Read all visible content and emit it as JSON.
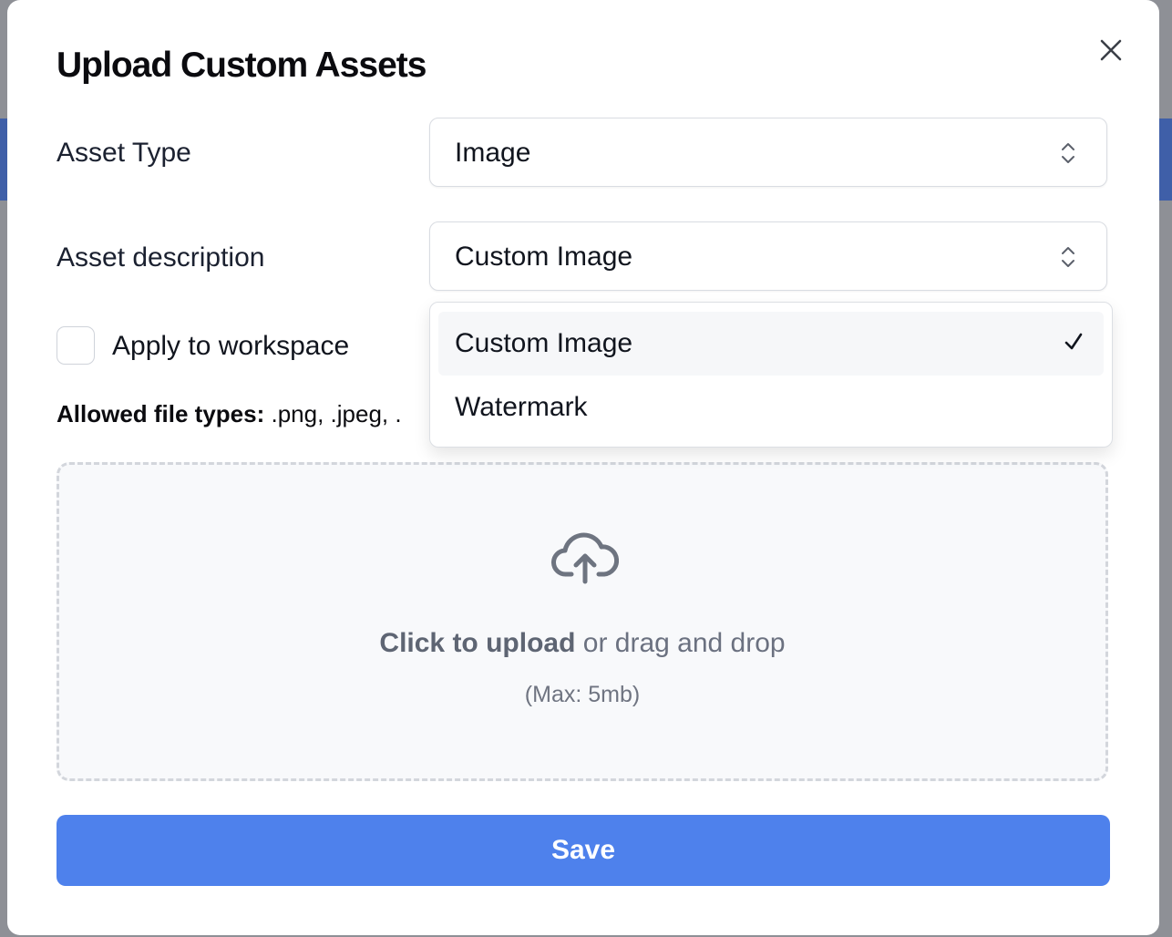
{
  "modal": {
    "title": "Upload Custom Assets"
  },
  "asset_type": {
    "label": "Asset Type",
    "value": "Image"
  },
  "asset_description": {
    "label": "Asset description",
    "value": "Custom Image",
    "options": [
      "Custom Image",
      "Watermark"
    ],
    "selected_index": 0
  },
  "apply_to_workspace": {
    "label": "Apply to workspace",
    "checked": false
  },
  "allowed_types": {
    "label": "Allowed file types:",
    "value": " .png, .jpeg, ."
  },
  "upload": {
    "primary": "Click to upload",
    "secondary": " or drag and drop",
    "max_size": "(Max: 5mb)"
  },
  "save_label": "Save",
  "icons": {
    "close": "close-icon",
    "chevron": "chevron-up-down-icon",
    "upload": "cloud-upload-icon",
    "check": "check-icon"
  },
  "colors": {
    "accent": "#4e81ec",
    "text": "#11151e",
    "muted": "#6b7180"
  }
}
